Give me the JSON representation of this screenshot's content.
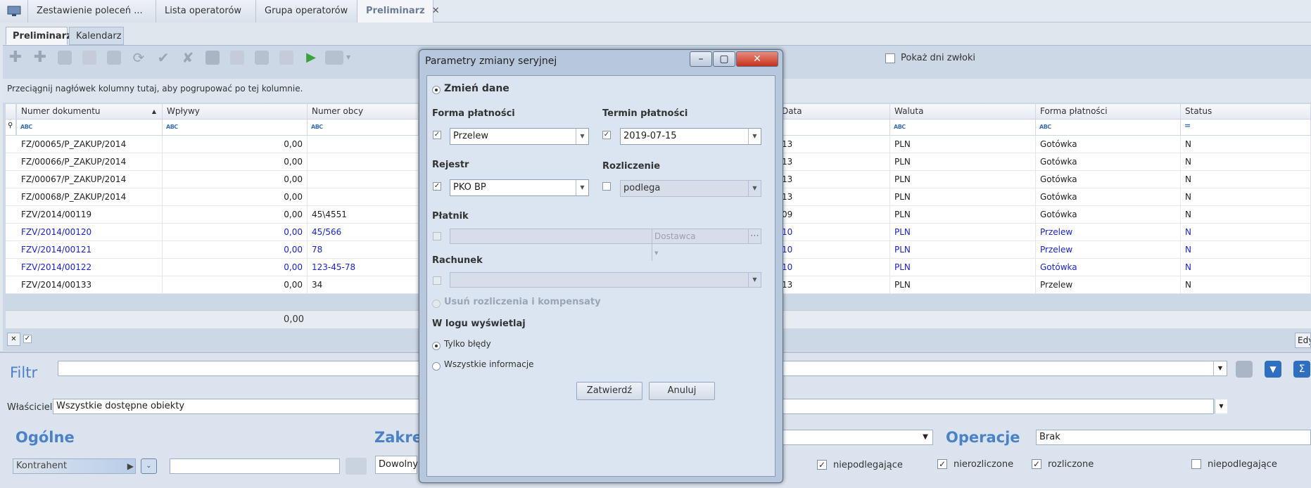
{
  "top_tabs": [
    {
      "label": "Zestawienie poleceń ..."
    },
    {
      "label": "Lista operatorów"
    },
    {
      "label": "Grupa operatorów"
    },
    {
      "label": "Preliminarz",
      "close": "✕"
    }
  ],
  "sub_tabs": [
    {
      "label": "Preliminarz"
    },
    {
      "label": "Kalendarz"
    }
  ],
  "toolbar": {
    "show_delay_label": "Pokaż dni zwłoki"
  },
  "group_hint": "Przeciągnij nagłówek kolumny tutaj, aby pogrupować po tej kolumnie.",
  "columns": {
    "doc_number": "Numer dokumentu",
    "inflows": "Wpływy",
    "foreign_number": "Numer obcy",
    "date": "Data",
    "currency": "Waluta",
    "payment_form": "Forma płatności",
    "status": "Status"
  },
  "rows": [
    {
      "doc": "FZ/00065/P_ZAKUP/2014",
      "inflow": "0,00",
      "foreign": "",
      "date": "13",
      "currency": "PLN",
      "payment": "Gotówka",
      "status": "N",
      "blue": false
    },
    {
      "doc": "FZ/00066/P_ZAKUP/2014",
      "inflow": "0,00",
      "foreign": "",
      "date": "13",
      "currency": "PLN",
      "payment": "Gotówka",
      "status": "N",
      "blue": false
    },
    {
      "doc": "FZ/00067/P_ZAKUP/2014",
      "inflow": "0,00",
      "foreign": "",
      "date": "13",
      "currency": "PLN",
      "payment": "Gotówka",
      "status": "N",
      "blue": false
    },
    {
      "doc": "FZ/00068/P_ZAKUP/2014",
      "inflow": "0,00",
      "foreign": "",
      "date": "13",
      "currency": "PLN",
      "payment": "Gotówka",
      "status": "N",
      "blue": false
    },
    {
      "doc": "FZV/2014/00119",
      "inflow": "0,00",
      "foreign": "45\\4551",
      "date": "09",
      "currency": "PLN",
      "payment": "Gotówka",
      "status": "N",
      "blue": false
    },
    {
      "doc": "FZV/2014/00120",
      "inflow": "0,00",
      "foreign": "45/566",
      "date": "10",
      "currency": "PLN",
      "payment": "Przelew",
      "status": "N",
      "blue": true
    },
    {
      "doc": "FZV/2014/00121",
      "inflow": "0,00",
      "foreign": "78",
      "date": "10",
      "currency": "PLN",
      "payment": "Przelew",
      "status": "N",
      "blue": true
    },
    {
      "doc": "FZV/2014/00122",
      "inflow": "0,00",
      "foreign": "123-45-78",
      "date": "10",
      "currency": "PLN",
      "payment": "Gotówka",
      "status": "N",
      "blue": true
    },
    {
      "doc": "FZV/2014/00133",
      "inflow": "0,00",
      "foreign": "34",
      "date": "13",
      "currency": "PLN",
      "payment": "Przelew",
      "status": "N",
      "blue": false
    }
  ],
  "footer_total": "0,00",
  "edit_label": "Edy",
  "filter": {
    "title": "Filtr",
    "owner_label": "Właściciel:",
    "owner_value": "Wszystkie dostępne obiekty"
  },
  "sections": {
    "general": "Ogólne",
    "range": "Zakres",
    "operations": "Operacje",
    "contractor": "Kontrahent",
    "range_value": "Dowolny",
    "operations_value": "Brak",
    "cb_niepodlegajace1": "niepodlegające",
    "cb_nierozliczone": "nierozliczone",
    "cb_rozliczone": "rozliczone",
    "cb_niepodlegajace2": "niepodlegające"
  },
  "dialog": {
    "title": "Parametry zmiany seryjnej",
    "change_data": "Zmień dane",
    "payment_form_label": "Forma płatności",
    "payment_form_value": "Przelew",
    "payment_term_label": "Termin płatności",
    "payment_term_value": "2019-07-15",
    "register_label": "Rejestr",
    "register_value": "PKO BP",
    "settlement_label": "Rozliczenie",
    "settlement_value": "podlega",
    "payer_label": "Płatnik",
    "payer_type": "Dostawca",
    "account_label": "Rachunek",
    "remove_settlements": "Usuń rozliczenia i kompensaty",
    "log_label": "W logu wyświetlaj",
    "only_errors": "Tylko błędy",
    "all_info": "Wszystkie informacje",
    "confirm": "Zatwierdź",
    "cancel": "Anuluj"
  }
}
